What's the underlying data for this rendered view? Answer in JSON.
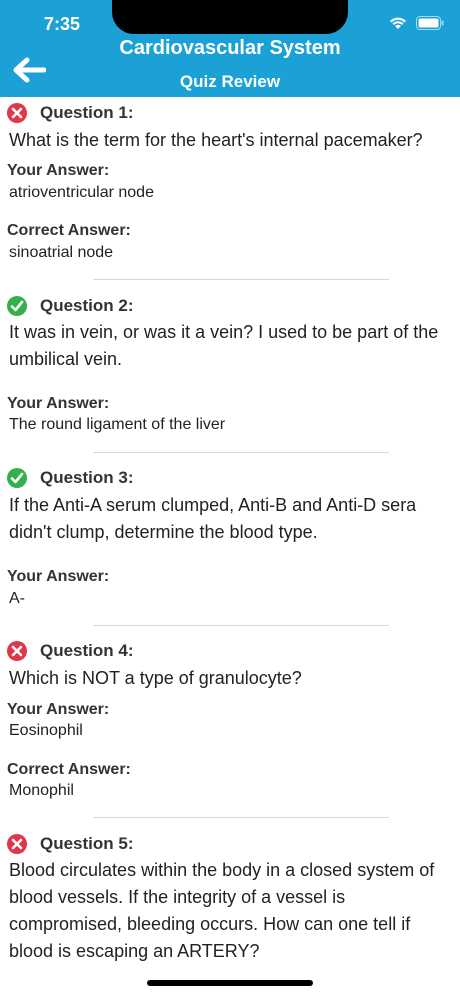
{
  "status": {
    "time": "7:35"
  },
  "header": {
    "title": "Cardiovascular System",
    "subtitle": "Quiz Review"
  },
  "labels": {
    "your_answer": "Your Answer:",
    "correct_answer": "Correct Answer:"
  },
  "colors": {
    "header_bg": "#1ba1d6",
    "wrong": "#e0364a",
    "right": "#33b04a"
  },
  "questions": [
    {
      "label": "Question 1:",
      "status": "wrong",
      "icon": "x-circle-icon",
      "text": "What is the term for the heart's internal pacemaker?",
      "your_answer": "atrioventricular node",
      "correct_answer": "sinoatrial node"
    },
    {
      "label": "Question 2:",
      "status": "correct",
      "icon": "check-circle-icon",
      "text": "It was in vein, or was it a vein? I used to be part of the umbilical vein.",
      "your_answer": "The round ligament of the liver"
    },
    {
      "label": "Question 3:",
      "status": "correct",
      "icon": "check-circle-icon",
      "text": "If the Anti-A serum clumped, Anti-B and Anti-D sera didn't clump, determine the blood type.",
      "your_answer": "A-"
    },
    {
      "label": "Question 4:",
      "status": "wrong",
      "icon": "x-circle-icon",
      "text": "Which is NOT a type of granulocyte?",
      "your_answer": "Eosinophil",
      "correct_answer": "Monophil"
    },
    {
      "label": "Question 5:",
      "status": "wrong",
      "icon": "x-circle-icon",
      "text": "Blood circulates within the body in a closed system of blood vessels. If the integrity of a vessel is compromised, bleeding occurs. How can one tell if blood is escaping an ARTERY?"
    }
  ]
}
